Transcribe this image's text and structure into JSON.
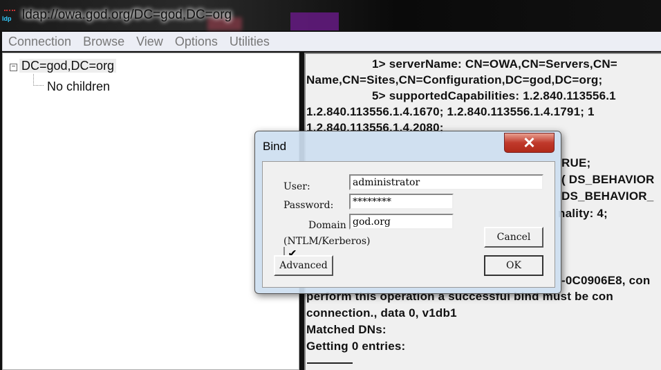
{
  "window": {
    "title": "ldap://owa.god.org/DC=god,DC=org",
    "icon": "ldp-app-icon",
    "icon_text": "ldp"
  },
  "menu": [
    "Connection",
    "Browse",
    "View",
    "Options",
    "Utilities"
  ],
  "tree": {
    "root": "DC=god,DC=org",
    "child": "No children"
  },
  "output": {
    "lines": [
      "1> serverName: CN=OWA,CN=Servers,CN=",
      "Name,CN=Sites,CN=Configuration,DC=god,DC=org;",
      "5> supportedCapabilities: 1.2.840.113556.1",
      "1.2.840.113556.1.4.1670; 1.2.840.113556.1.4.1791; 1",
      "1.2.840.113556.1.4.2080;",
      "RUE;",
      "( DS_BEHAVIOR",
      "DS_BEHAVIOR_",
      "nality: 4;",
      "-0C0906E8, con",
      "perform this operation a successful bind must be con",
      "connection., data 0, v1db1",
      "Matched DNs:",
      "Getting 0 entries:"
    ]
  },
  "dialog": {
    "title": "Bind",
    "close_icon": "close-icon",
    "user_label": "User:",
    "user_value": "administrator",
    "password_label": "Password:",
    "password_value": "********",
    "domain_checked": true,
    "domain_label": "Domain",
    "domain_value": "god.org",
    "domain_note": "(NTLM/Kerberos)",
    "cancel": "Cancel",
    "ok": "OK",
    "advanced": "Advanced"
  }
}
